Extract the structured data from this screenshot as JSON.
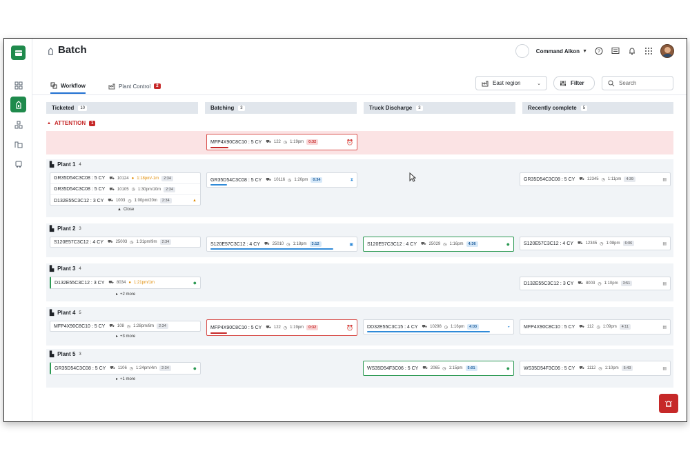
{
  "header": {
    "title": "Batch",
    "org_name": "Command Alkon"
  },
  "tabs": [
    {
      "label": "Workflow"
    },
    {
      "label": "Plant Control",
      "badge": "2"
    }
  ],
  "toolbar": {
    "region": "East region",
    "filter_label": "Filter",
    "search_placeholder": "Search"
  },
  "columns": [
    {
      "label": "Ticketed",
      "count": "10"
    },
    {
      "label": "Batching",
      "count": "3"
    },
    {
      "label": "Truck Discharge",
      "count": "3"
    },
    {
      "label": "Recently complete",
      "count": "5"
    }
  ],
  "attention": {
    "label": "ATTENTION",
    "count": "1",
    "card": {
      "id": "MFP4X90C8C10 : 5 CY",
      "truck": "122",
      "time": "1:19pm",
      "timer": "0:32"
    }
  },
  "plants": [
    {
      "name": "Plant 1",
      "count": "4",
      "ticketed": [
        {
          "id": "GR35D54C3C08 : 5 CY",
          "truck": "10124",
          "time": "1:18pm/-1m",
          "timer": "2:34"
        },
        {
          "id": "GR35D54C3C08 : 5 CY",
          "truck": "10105",
          "time": "1:30pm/10m",
          "timer": "2:34"
        },
        {
          "id": "D132E55C3C12 : 3 CY",
          "truck": "1003",
          "time": "1:00pm/20m",
          "timer": "2:34"
        }
      ],
      "ticketed_more": "Close",
      "batching": {
        "id": "GR35D54C3C08 : 5 CY",
        "truck": "10116",
        "time": "1:20pm",
        "timer": "0:34"
      },
      "complete": {
        "id": "GR35D54C3C08 : 5 CY",
        "truck": "12345",
        "time": "1:11pm",
        "timer": "4:39"
      }
    },
    {
      "name": "Plant 2",
      "count": "3",
      "ticketed": [
        {
          "id": "S120E57C3C12 : 4 CY",
          "truck": "25003",
          "time": "1:31pm/9m",
          "timer": "2:34"
        }
      ],
      "batching": {
        "id": "S120E57C3C12 : 4 CY",
        "truck": "25010",
        "time": "1:18pm",
        "timer": "3:12"
      },
      "discharge": {
        "id": "S120E57C3C12 : 4 CY",
        "truck": "25029",
        "time": "1:16pm",
        "timer": "4:36"
      },
      "complete": {
        "id": "S120E57C3C12 : 4 CY",
        "truck": "12345",
        "time": "1:08pm",
        "timer": "6:06"
      }
    },
    {
      "name": "Plant 3",
      "count": "4",
      "ticketed": [
        {
          "id": "D132E55C3C12 : 3 CY",
          "truck": "8034",
          "time": "1:21pm/1m",
          "timer": ""
        }
      ],
      "ticketed_more": "+2 more",
      "complete": {
        "id": "D132E55C3C12 : 3 CY",
        "truck": "8003",
        "time": "1:10pm",
        "timer": "3:51"
      }
    },
    {
      "name": "Plant 4",
      "count": "5",
      "ticketed": [
        {
          "id": "MFP4X90C8C10 : 5 CY",
          "truck": "108",
          "time": "1:28pm/8m",
          "timer": "2:34"
        }
      ],
      "ticketed_more": "+3 more",
      "batching": {
        "id": "MFP4X90C8C10 : 5 CY",
        "truck": "122",
        "time": "1:19pm",
        "timer": "0:32"
      },
      "discharge": {
        "id": "DD32E55C3C15 : 4 CY",
        "truck": "10298",
        "time": "1:16pm",
        "timer": "4:03"
      },
      "complete": {
        "id": "MFP4X90C8C10 : 5 CY",
        "truck": "112",
        "time": "1:09pm",
        "timer": "4:11"
      }
    },
    {
      "name": "Plant 5",
      "count": "3",
      "ticketed": [
        {
          "id": "GR35D54C3C08 : 5 CY",
          "truck": "1106",
          "time": "1:24pm/4m",
          "timer": "2:34"
        }
      ],
      "ticketed_more": "+1 more",
      "discharge": {
        "id": "WS35D54F3C06 : 5 CY",
        "truck": "2065",
        "time": "1:15pm",
        "timer": "5:01"
      },
      "complete": {
        "id": "WS35D54F3C06 : 5 CY",
        "truck": "1112",
        "time": "1:10pm",
        "timer": "5:43"
      }
    }
  ],
  "colors": {
    "brand": "#1f8a4c",
    "alert": "#c62828",
    "progress": "#2f8ad8"
  }
}
